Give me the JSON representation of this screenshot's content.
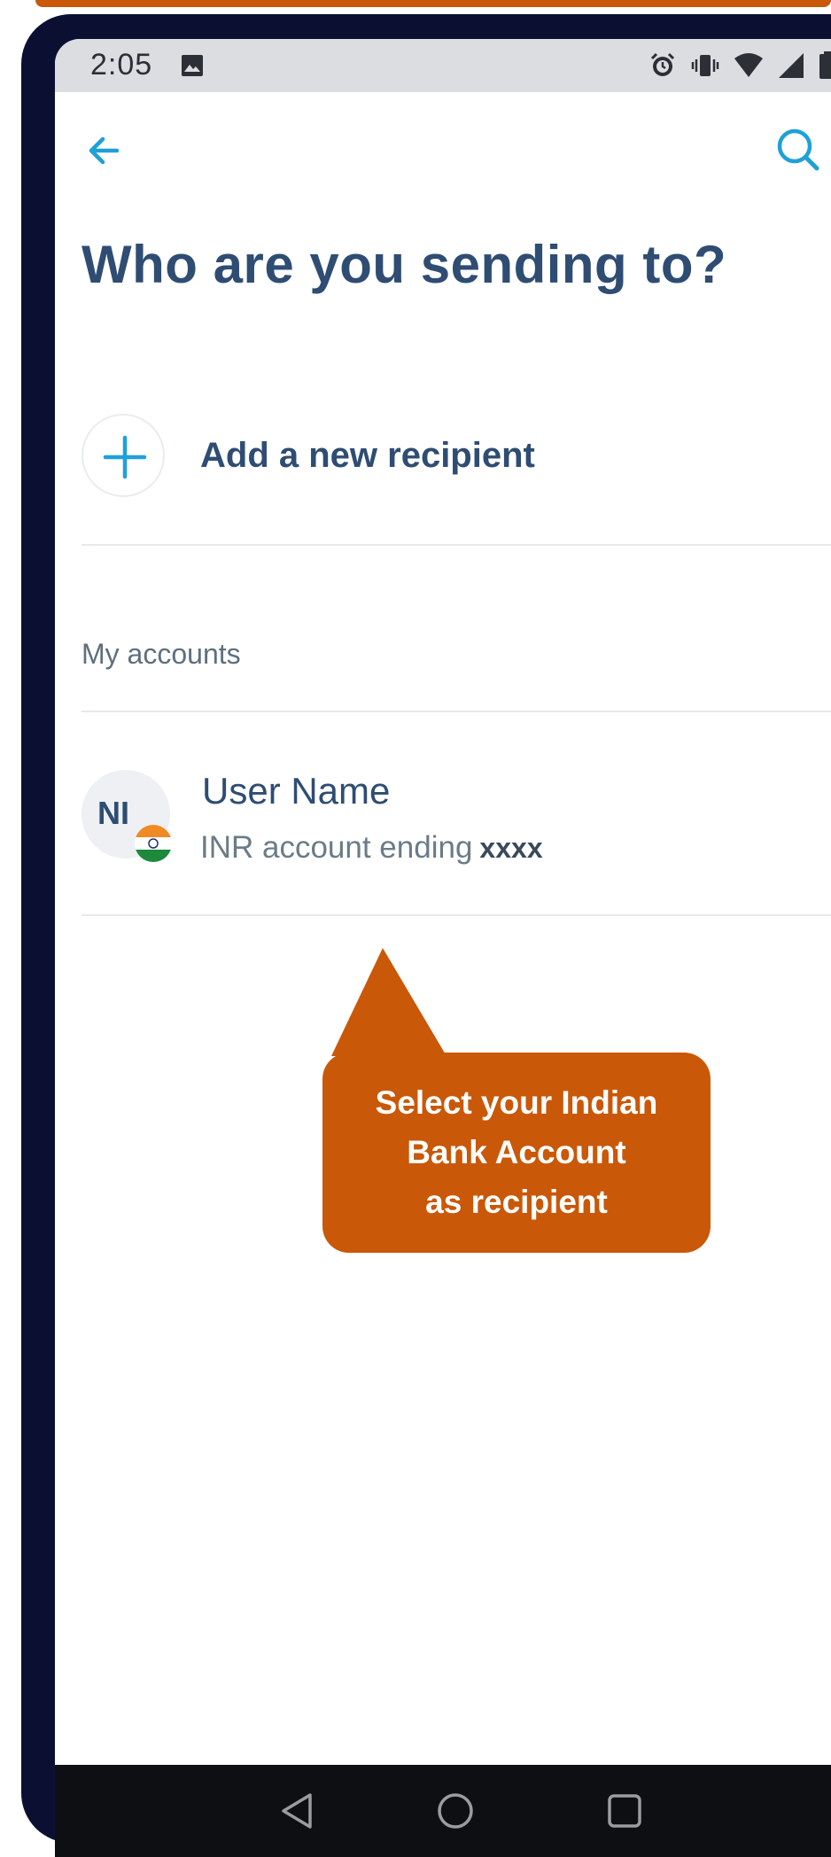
{
  "status_bar": {
    "time": "2:05",
    "icons": [
      "image-icon",
      "alarm-icon",
      "vibrate-icon",
      "wifi-icon",
      "signal-icon",
      "battery-icon"
    ]
  },
  "app_bar": {
    "back_icon": "arrow-left-icon",
    "search_icon": "search-icon"
  },
  "page": {
    "title": "Who are you sending to?"
  },
  "add_recipient": {
    "label": "Add a new recipient",
    "icon": "plus-icon"
  },
  "my_accounts": {
    "section_label": "My accounts",
    "accounts": [
      {
        "initials": "NI",
        "name": "User Name",
        "subtitle": "INR account ending",
        "account_suffix": "xxxx",
        "flag": "india-flag-icon"
      }
    ]
  },
  "callout": {
    "lines": [
      "Select your Indian",
      "Bank Account",
      "as recipient"
    ]
  },
  "nav_bar": {
    "buttons": [
      "back-triangle-icon",
      "home-circle-icon",
      "recents-square-icon"
    ]
  },
  "colors": {
    "accent": "#1fa0d8",
    "title": "#2f4d73",
    "callout": "#c95808",
    "frame": "#0b1033"
  }
}
